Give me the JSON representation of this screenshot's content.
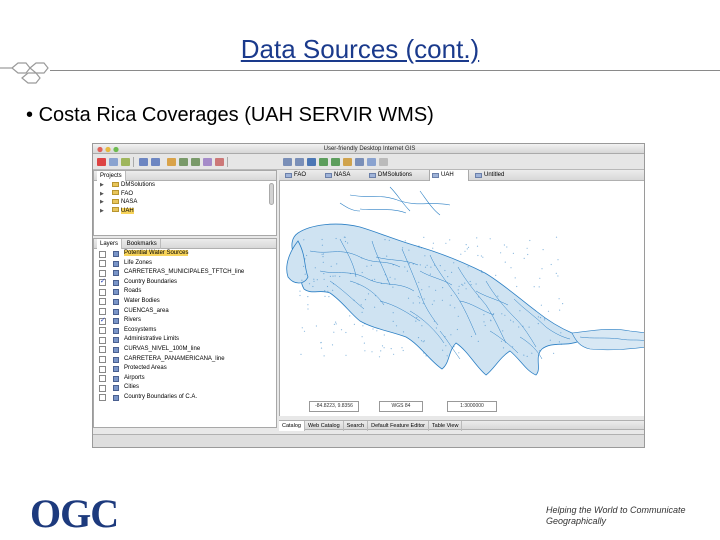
{
  "slide": {
    "title": "Data Sources (cont.)",
    "bullet": "Costa Rica Coverages (UAH SERVIR WMS)",
    "footer_tagline": "Helping the World to Communicate Geographically",
    "logo_text": "OGC",
    "colors": {
      "title": "#1a3a8c",
      "logo": "#1d3a7d"
    }
  },
  "app": {
    "window_title": "User-friendly Desktop Internet GIS",
    "projects_panel": {
      "tab_label": "Projects",
      "items": [
        {
          "label": "DMSolutions",
          "selected": false
        },
        {
          "label": "FAO",
          "selected": false
        },
        {
          "label": "NASA",
          "selected": false
        },
        {
          "label": "UAH",
          "selected": true
        }
      ]
    },
    "layers_panel": {
      "tabs": [
        "Layers",
        "Bookmarks"
      ],
      "layers": [
        {
          "label": "Potential Water Sources",
          "checked": false,
          "selected": true
        },
        {
          "label": "Life Zones",
          "checked": false,
          "selected": false
        },
        {
          "label": "CARRETERAS_MUNICIPALES_TFTCH_line",
          "checked": false,
          "selected": false
        },
        {
          "label": "Country Boundaries",
          "checked": true,
          "selected": false
        },
        {
          "label": "Roads",
          "checked": false,
          "selected": false
        },
        {
          "label": "Water Bodies",
          "checked": false,
          "selected": false
        },
        {
          "label": "CUENCAS_area",
          "checked": false,
          "selected": false
        },
        {
          "label": "Rivers",
          "checked": true,
          "selected": false
        },
        {
          "label": "Ecosystems",
          "checked": false,
          "selected": false
        },
        {
          "label": "Administrative Limits",
          "checked": false,
          "selected": false
        },
        {
          "label": "CURVAS_NIVEL_100M_line",
          "checked": false,
          "selected": false
        },
        {
          "label": "CARRETERA_PANAMERICANA_line",
          "checked": false,
          "selected": false
        },
        {
          "label": "Protected Areas",
          "checked": false,
          "selected": false
        },
        {
          "label": "Airports",
          "checked": false,
          "selected": false
        },
        {
          "label": "Cities",
          "checked": false,
          "selected": false
        },
        {
          "label": "Country Boundaries of C.A.",
          "checked": false,
          "selected": false
        }
      ]
    },
    "map_tabs": [
      {
        "label": "FAO",
        "active": false
      },
      {
        "label": "NASA",
        "active": false
      },
      {
        "label": "DMSolutions",
        "active": false
      },
      {
        "label": "UAH",
        "active": true
      },
      {
        "label": "Untitled",
        "active": false
      }
    ],
    "status": {
      "coordinates": "-84.8223, 9.8356",
      "crs": "WGS 84",
      "scale": "1:3000000"
    },
    "bottom_tabs": [
      {
        "label": "Catalog",
        "active": true
      },
      {
        "label": "Web Catalog",
        "active": false
      },
      {
        "label": "Search",
        "active": false
      },
      {
        "label": "Default Feature Editor",
        "active": false
      },
      {
        "label": "Table View",
        "active": false
      }
    ],
    "colors": {
      "water": "#2b7fc4",
      "highlight": "#f7d35a"
    }
  }
}
